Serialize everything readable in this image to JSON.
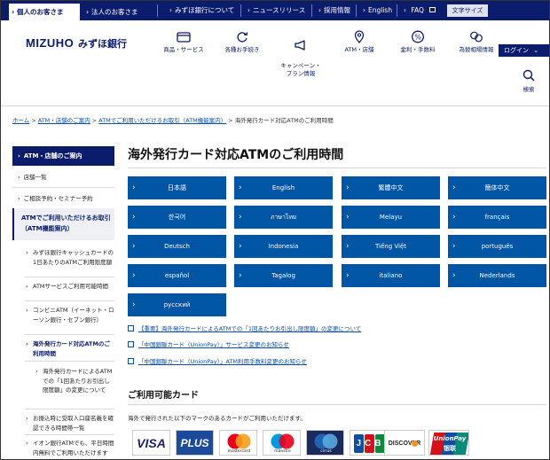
{
  "topbar": {
    "segments": [
      "個人のお客さま",
      "法人のお客さま"
    ],
    "utility_links": [
      "みずほ銀行について",
      "ニュースリリース",
      "採用情報",
      "English",
      "FAQ"
    ],
    "font_size_label": "文字サイズ"
  },
  "header": {
    "logo_mark": "MIZUHO",
    "logo_jp": "みずほ銀行",
    "nav": [
      {
        "label": "商品・サービス",
        "icon": "card-icon"
      },
      {
        "label": "各種お手続き",
        "icon": "refresh-icon"
      },
      {
        "label": "キャンペーン・\nプラン情報",
        "icon": "megaphone-icon"
      },
      {
        "label": "ATM・店舗",
        "icon": "location-pin-icon"
      },
      {
        "label": "金利・手数料",
        "icon": "percent-icon"
      },
      {
        "label": "為替相場情報",
        "icon": "exchange-icon"
      }
    ],
    "login_label": "ログイン",
    "search_label": "検索"
  },
  "breadcrumb": {
    "links": [
      "ホーム",
      "ATM・店舗のご案内",
      "ATMでご利用いただけるお取引（ATM機能案内）"
    ],
    "current": "海外発行カード対応ATMのご利用時間"
  },
  "sidebar": {
    "heading": "ATM・店舗のご案内",
    "items": [
      "店舗一覧",
      "ご相談予約・セミナー予約"
    ],
    "active_section": "ATMでご利用いただけるお取引（ATM機能案内）",
    "subitems": [
      "みずほ銀行キャッシュカードの1日あたりのATMご利用限度額",
      "ATMサービスご利用可能時間",
      "コンビニATM（イーネット・ローソン銀行・セブン銀行）",
      "海外発行カード対応ATMのご利用時間"
    ],
    "nested": [
      "海外発行カードによるATMでの「1回あたりお引出し限度額」の変更について"
    ],
    "more": [
      "お振込時に受取人口座名義を確認できる時間帯一覧",
      "イオン銀行ATMでも、平日時間内無料でご利用いただけます"
    ]
  },
  "main": {
    "title": "海外発行カード対応ATMのご利用時間",
    "languages": [
      "日本語",
      "English",
      "繁體中文",
      "簡体中文",
      "한국어",
      "ภาษาไทย",
      "Melayu",
      "français",
      "Deutsch",
      "Indonesia",
      "Tiếng Việt",
      "português",
      "español",
      "Tagalog",
      "italiano",
      "Nederlands",
      "русский"
    ],
    "notices": [
      "【重要】海外発行カードによるATMでの「1回あたりお引出し限度額」の変更について",
      "「中国銀聯カード（UnionPay）」サービス変更のお知らせ",
      "「中国銀聯カード（UnionPay）」ATM利用手数料変更のお知らせ"
    ],
    "cards_title": "ご利用可能カード",
    "cards_desc": "海外で発行された以下のマークのあるカードがご利用いただけます。",
    "cards": [
      {
        "name": "VISA",
        "caption": ""
      },
      {
        "name": "PLUS",
        "caption": ""
      },
      {
        "name": "mastercard",
        "caption": "mastercard"
      },
      {
        "name": "maestro",
        "caption": "maestro"
      },
      {
        "name": "cirrus",
        "caption": "cirrus"
      },
      {
        "name": "JCB",
        "caption": ""
      },
      {
        "name": "DISCOVER",
        "caption": ""
      },
      {
        "name": "UnionPay",
        "caption": "银联"
      }
    ]
  },
  "colors": {
    "navy": "#0a1c6b",
    "button_blue": "#0055a5",
    "link_blue": "#0a4fa8",
    "mastercard_red": "#eb001b",
    "mastercard_orange": "#f79e1b",
    "jcb_green": "#0b8a3e",
    "unionpay_red": "#d4121a"
  }
}
